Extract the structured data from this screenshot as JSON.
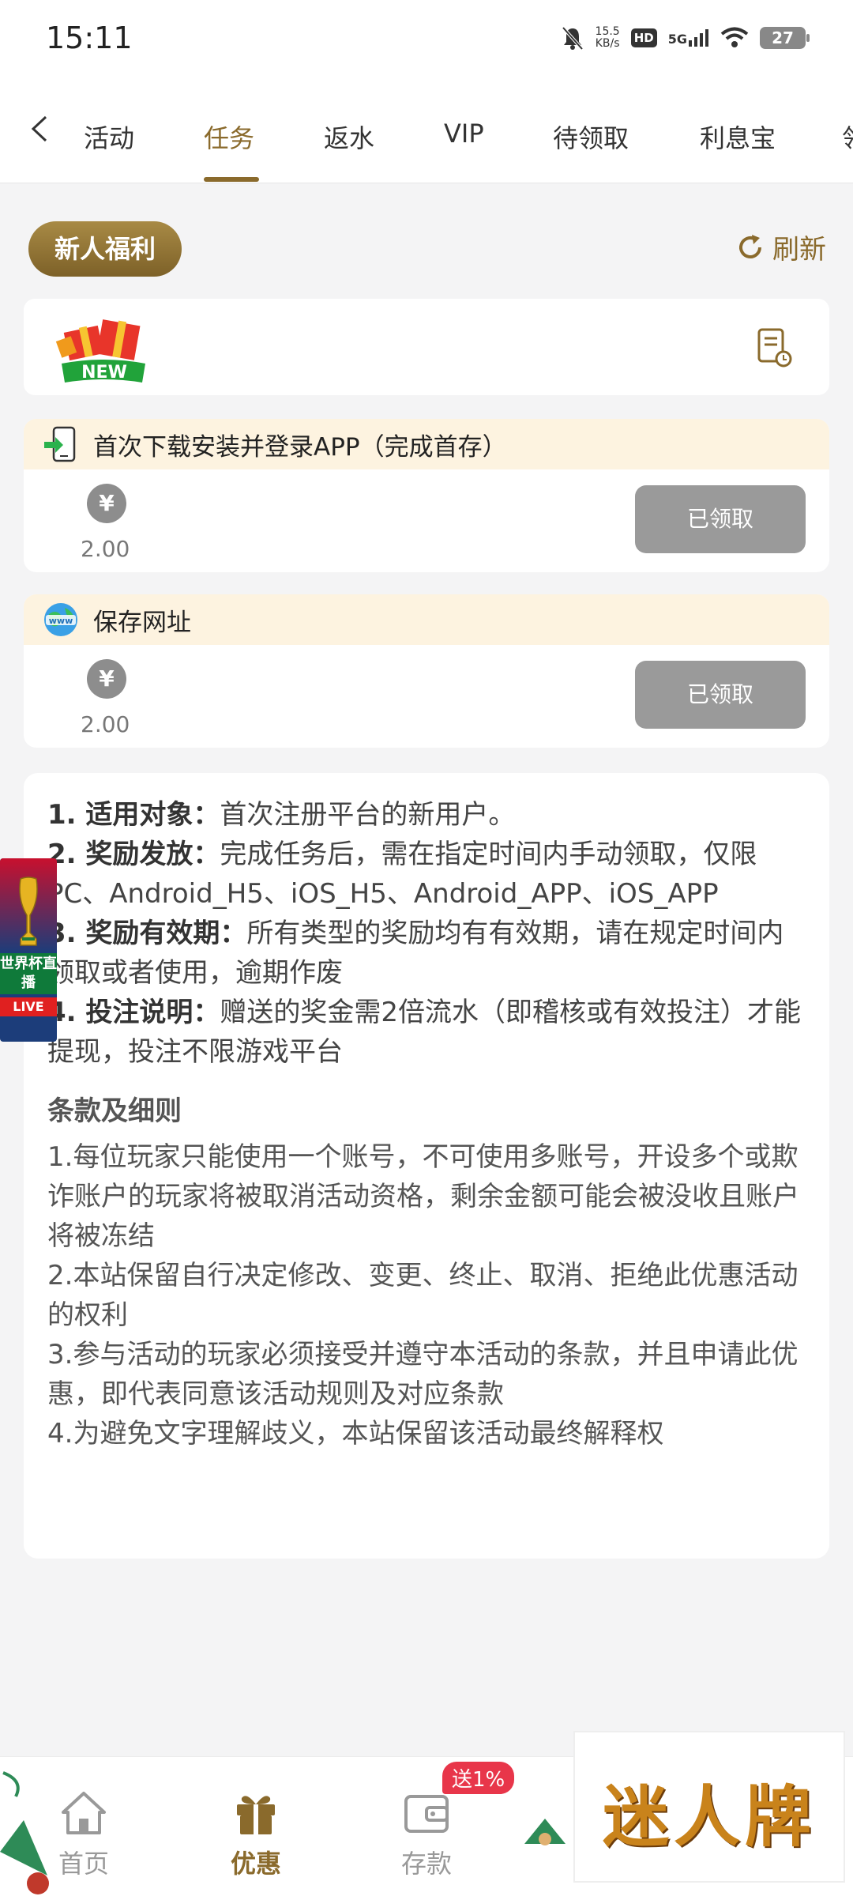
{
  "status_bar": {
    "time": "15:11",
    "speed_value": "15.5",
    "speed_unit": "KB/s",
    "hd": "HD",
    "network": "5G",
    "battery": "27"
  },
  "nav": {
    "tabs": [
      "活动",
      "任务",
      "返水",
      "VIP",
      "待领取",
      "利息宝",
      "领"
    ],
    "active_index": 1
  },
  "section": {
    "pill_label": "新人福利",
    "refresh_label": "刷新",
    "badge_text": "NEW"
  },
  "tasks": [
    {
      "title": "首次下载安装并登录APP（完成首存）",
      "currency_symbol": "¥",
      "amount": "2.00",
      "button": "已领取"
    },
    {
      "title": "保存网址",
      "currency_symbol": "¥",
      "amount": "2.00",
      "button": "已领取"
    }
  ],
  "info": {
    "items": [
      {
        "label": "1. 适用对象：",
        "text": "首次注册平台的新用户。"
      },
      {
        "label": "2. 奖励发放：",
        "text": "完成任务后，需在指定时间内手动领取，仅限PC、Android_H5、iOS_H5、Android_APP、iOS_APP"
      },
      {
        "label": "3. 奖励有效期：",
        "text": "所有类型的奖励均有有效期，请在规定时间内领取或者使用，逾期作废"
      },
      {
        "label": "4. 投注说明：",
        "text": "赠送的奖金需2倍流水（即稽核或有效投注）才能提现，投注不限游戏平台"
      }
    ],
    "terms_title": "条款及细则",
    "terms": [
      "1.每位玩家只能使用一个账号，不可使用多账号，开设多个或欺诈账户的玩家将被取消活动资格，剩余金额可能会被没收且账户将被冻结",
      "2.本站保留自行决定修改、变更、终止、取消、拒绝此优惠活动的权利",
      "3.参与活动的玩家必须接受并遵守本活动的条款，并且申请此优惠，即代表同意该活动规则及对应条款",
      "4.为避免文字理解歧义，本站保留该活动最终解释权"
    ]
  },
  "float_badge": {
    "title": "世界杯直播",
    "live": "LIVE"
  },
  "bottom_nav": {
    "items": [
      "首页",
      "优惠",
      "存款"
    ],
    "active_index": 1,
    "promo": "送1%"
  },
  "brand": "迷人牌",
  "colors": {
    "accent": "#8a6a2c",
    "card_header": "#fdf3e0",
    "button_disabled": "#9a9a9a",
    "promo": "#e8364a"
  }
}
